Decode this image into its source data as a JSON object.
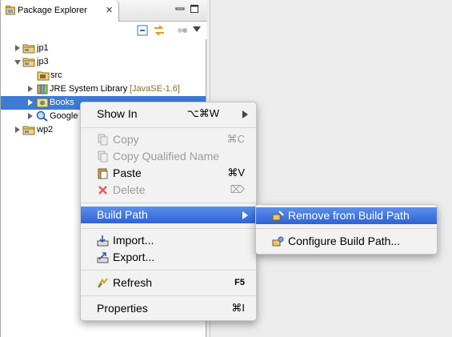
{
  "view": {
    "title": "Package Explorer",
    "close_glyph": "✕"
  },
  "tree": [
    {
      "label": "jp1",
      "decoration": "",
      "expanded": false,
      "icon": "project-folder-icon"
    },
    {
      "label": "jp3",
      "decoration": "",
      "expanded": true,
      "icon": "project-folder-icon"
    },
    {
      "label": "src",
      "decoration": "",
      "expanded": null,
      "icon": "source-folder-icon"
    },
    {
      "label": "JRE System Library",
      "decoration": "[JavaSE-1.6]",
      "expanded": false,
      "icon": "library-icon"
    },
    {
      "label": "Books",
      "decoration": "",
      "expanded": false,
      "icon": "jar-library-icon",
      "selected": true
    },
    {
      "label": "Google",
      "decoration": "",
      "expanded": false,
      "icon": "search-library-icon"
    },
    {
      "label": "wp2",
      "decoration": "",
      "expanded": false,
      "icon": "project-folder-icon"
    }
  ],
  "context_menu": {
    "show_in": {
      "label": "Show In",
      "shortcut": "⌥⌘W"
    },
    "copy": {
      "label": "Copy",
      "shortcut": "⌘C"
    },
    "copy_qualified": {
      "label": "Copy Qualified Name"
    },
    "paste": {
      "label": "Paste",
      "shortcut": "⌘V"
    },
    "delete": {
      "label": "Delete",
      "shortcut": "⌦"
    },
    "build_path": {
      "label": "Build Path"
    },
    "import": {
      "label": "Import..."
    },
    "export": {
      "label": "Export..."
    },
    "refresh": {
      "label": "Refresh",
      "shortcut": "F5"
    },
    "properties": {
      "label": "Properties",
      "shortcut": "⌘I"
    }
  },
  "submenu": {
    "remove": {
      "label": "Remove from Build Path"
    },
    "configure": {
      "label": "Configure Build Path..."
    }
  },
  "colors": {
    "selection": "#3e7bd6",
    "menu_highlight": "#2f63d6",
    "decoration": "#8a6a2a"
  }
}
